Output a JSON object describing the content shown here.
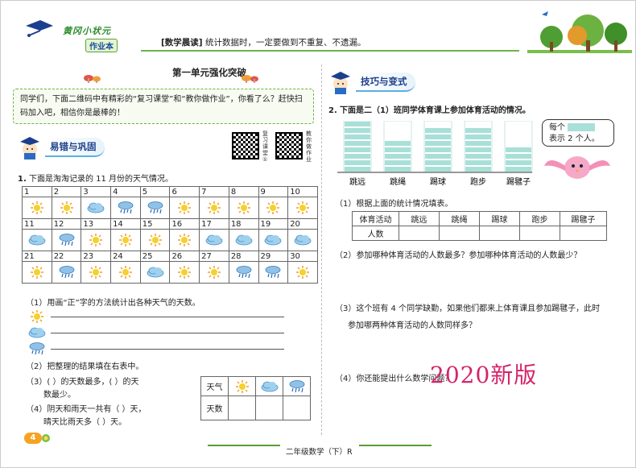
{
  "header": {
    "logo_title": "黄冈小状元",
    "logo_sub": "作业本",
    "tag": "[数学晨读]",
    "note": "统计数据时，一定要做到不重复、不遗漏。"
  },
  "unit_title": "第一单元强化突破",
  "intro": "同学们，下面二维码中有精彩的“复习课堂”和“教你做作业”，你看了么？赶快扫码加入吧，相信你是最棒的！",
  "left_section": {
    "badge": "易错与巩固",
    "qr1_label": "复习课堂①",
    "qr2_label": "教你做作业",
    "q1_num": "1.",
    "q1_text": "下面是淘淘记录的 11 月份的天气情况。",
    "calendar": [
      {
        "day": "1",
        "w": "sunny"
      },
      {
        "day": "2",
        "w": "sunny"
      },
      {
        "day": "3",
        "w": "cloudy"
      },
      {
        "day": "4",
        "w": "rainy"
      },
      {
        "day": "5",
        "w": "rainy"
      },
      {
        "day": "6",
        "w": "sunny"
      },
      {
        "day": "7",
        "w": "sunny"
      },
      {
        "day": "8",
        "w": "sunny"
      },
      {
        "day": "9",
        "w": "sunny"
      },
      {
        "day": "10",
        "w": "sunny"
      },
      {
        "day": "11",
        "w": "cloudy"
      },
      {
        "day": "12",
        "w": "rainy"
      },
      {
        "day": "13",
        "w": "sunny"
      },
      {
        "day": "14",
        "w": "sunny"
      },
      {
        "day": "15",
        "w": "sunny"
      },
      {
        "day": "16",
        "w": "sunny"
      },
      {
        "day": "17",
        "w": "cloudy"
      },
      {
        "day": "18",
        "w": "cloudy"
      },
      {
        "day": "19",
        "w": "cloudy"
      },
      {
        "day": "20",
        "w": "cloudy"
      },
      {
        "day": "21",
        "w": "sunny"
      },
      {
        "day": "22",
        "w": "rainy"
      },
      {
        "day": "23",
        "w": "sunny"
      },
      {
        "day": "24",
        "w": "sunny"
      },
      {
        "day": "25",
        "w": "cloudy"
      },
      {
        "day": "26",
        "w": "sunny"
      },
      {
        "day": "27",
        "w": "sunny"
      },
      {
        "day": "28",
        "w": "rainy"
      },
      {
        "day": "29",
        "w": "rainy"
      },
      {
        "day": "30",
        "w": "sunny"
      }
    ],
    "sub1": "（1）用画“正”字的方法统计出各种天气的天数。",
    "sub2": "（2）把整理的结果填在右表中。",
    "sub3a": "（3）(        ）的天数最多，(        ）的天",
    "sub3b": "数最少。",
    "sub4a": "（4）阴天和雨天一共有（        ）天，",
    "sub4b": "晴天比雨天多（      ）天。",
    "table_row1": "天气",
    "table_row2": "天数"
  },
  "right_section": {
    "badge": "技巧与变式",
    "q2_num": "2.",
    "q2_text": "下面是二（1）班同学体育课上参加体育活动的情况。",
    "chart_data": {
      "type": "bar",
      "categories": [
        "跳远",
        "跳绳",
        "踢球",
        "跑步",
        "踢毽子"
      ],
      "values": [
        8,
        5,
        7,
        7,
        4
      ],
      "ylim": [
        0,
        8
      ]
    },
    "bubble_line1": "每个",
    "bubble_line2": "表示 2 个人。",
    "sub1": "（1）根据上面的统计情况填表。",
    "table_head": [
      "体育活动",
      "跳远",
      "跳绳",
      "踢球",
      "跑步",
      "踢毽子"
    ],
    "table_row2_label": "人数",
    "sub2": "（2）参加哪种体育活动的人数最多？参加哪种体育活动的人数最少？",
    "sub3a": "（3）这个班有 4 个同学缺勤，如果他们都来上体育课且参加踢毽子，此时",
    "sub3b": "参加哪两种体育活动的人数同样多？",
    "sub4": "（4）你还能提出什么数学问题？"
  },
  "watermark": "2020新版",
  "footer": {
    "page_num": "4",
    "book": "二年级数学（下）R"
  },
  "colors": {
    "bar_fill": "#a8e0d8",
    "accent_green": "#6fb24a",
    "watermark": "#d3246a",
    "badge_text": "#1c3e8a"
  }
}
